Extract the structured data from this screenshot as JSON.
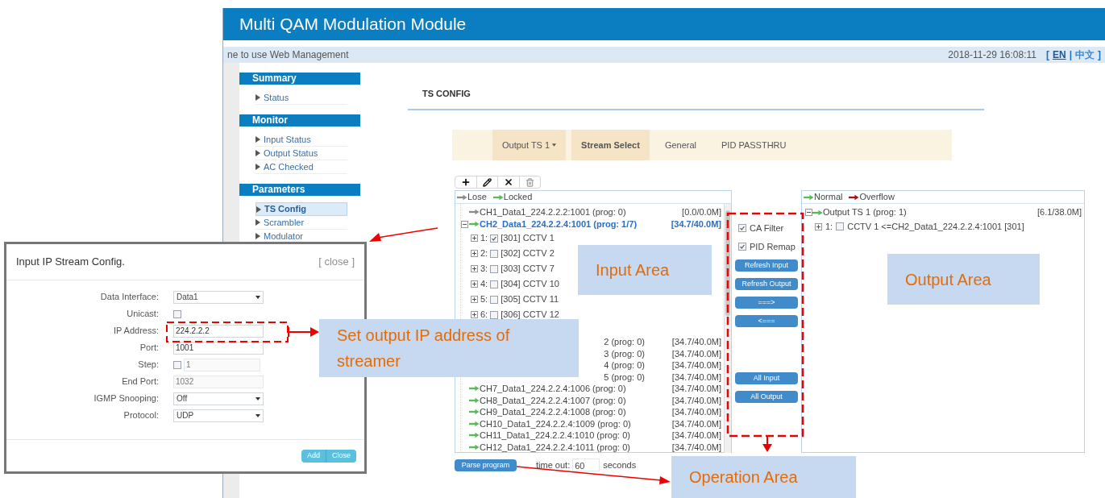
{
  "window": {
    "title": "Multi QAM Modulation Module"
  },
  "top_bar": {
    "welcome": "ne to use Web Management",
    "datetime": "2018-11-29 16:08:11",
    "language_switch": {
      "open": "[",
      "separator": "|",
      "close": "]",
      "languages": [
        {
          "label": "EN",
          "selected": true
        },
        {
          "label": "中文",
          "selected": false
        }
      ]
    }
  },
  "sidebar": {
    "sections": [
      {
        "title": "Summary",
        "items": [
          {
            "label": "Status",
            "selected": false
          }
        ]
      },
      {
        "title": "Monitor",
        "items": [
          {
            "label": "Input Status",
            "selected": false
          },
          {
            "label": "Output Status",
            "selected": false
          },
          {
            "label": "AC Checked",
            "selected": false
          }
        ]
      },
      {
        "title": "Parameters",
        "items": [
          {
            "label": "TS Config",
            "selected": true
          },
          {
            "label": "Scrambler",
            "selected": false
          },
          {
            "label": "Modulator",
            "selected": false
          }
        ]
      }
    ]
  },
  "page_title": "TS CONFIG",
  "tabs": [
    {
      "label": "Output TS 1",
      "kind": "dropdown",
      "selected": false
    },
    {
      "label": "Stream Select",
      "kind": "tab",
      "selected": true
    },
    {
      "label": "General",
      "kind": "tab",
      "selected": false
    },
    {
      "label": "PID PASSTHRU",
      "kind": "tab",
      "selected": false
    }
  ],
  "input_panel": {
    "legend": [
      {
        "label": "Lose",
        "color": "#8a8a8a"
      },
      {
        "label": "Locked",
        "color": "#5cb85c"
      }
    ],
    "channels": [
      {
        "kind": "channel",
        "label": "CH1_Data1_224.2.2.2:1001 (prog: 0)",
        "rate": "[0.0/0.0M]",
        "color": "#8a8a8a",
        "selected": false
      },
      {
        "kind": "channel",
        "label": "CH2_Data1_224.2.2.4:1001 (prog: 1/7)",
        "rate": "[34.7/40.0M]",
        "color": "#5cb85c",
        "selected": true,
        "expanded": true,
        "children": [
          {
            "number": "1:",
            "checked": true,
            "label": "[301] CCTV 1",
            "expanded": false
          },
          {
            "number": "2:",
            "checked": false,
            "label": "[302] CCTV 2",
            "expanded": false
          },
          {
            "number": "3:",
            "checked": false,
            "label": "[303] CCTV 7",
            "expanded": false
          },
          {
            "number": "4:",
            "checked": false,
            "label": "[304] CCTV 10",
            "expanded": false
          },
          {
            "number": "5:",
            "checked": false,
            "label": "[305] CCTV 11",
            "expanded": false
          },
          {
            "number": "6:",
            "checked": false,
            "label": "[306] CCTV 12",
            "expanded": false
          }
        ]
      },
      {
        "kind": "partial",
        "label": "2 (prog: 0)",
        "rate": "[34.7/40.0M]",
        "selected": false
      },
      {
        "kind": "partial",
        "label": "3 (prog: 0)",
        "rate": "[34.7/40.0M]",
        "selected": false
      },
      {
        "kind": "partial",
        "label": "4 (prog: 0)",
        "rate": "[34.7/40.0M]",
        "selected": false
      },
      {
        "kind": "partial",
        "label": "5 (prog: 0)",
        "rate": "[34.7/40.0M]",
        "selected": false
      },
      {
        "kind": "channel",
        "label": "CH7_Data1_224.2.2.4:1006 (prog: 0)",
        "rate": "[34.7/40.0M]",
        "color": "#5cb85c",
        "selected": false
      },
      {
        "kind": "channel",
        "label": "CH8_Data1_224.2.2.4:1007 (prog: 0)",
        "rate": "[34.7/40.0M]",
        "color": "#5cb85c",
        "selected": false
      },
      {
        "kind": "channel",
        "label": "CH9_Data1_224.2.2.4:1008 (prog: 0)",
        "rate": "[34.7/40.0M]",
        "color": "#5cb85c",
        "selected": false
      },
      {
        "kind": "channel",
        "label": "CH10_Data1_224.2.2.4:1009 (prog: 0)",
        "rate": "[34.7/40.0M]",
        "color": "#5cb85c",
        "selected": false
      },
      {
        "kind": "channel",
        "label": "CH11_Data1_224.2.2.4:1010 (prog: 0)",
        "rate": "[34.7/40.0M]",
        "color": "#5cb85c",
        "selected": false
      },
      {
        "kind": "channel",
        "label": "CH12_Data1_224.2.2.4:1011 (prog: 0)",
        "rate": "[34.7/40.0M]",
        "color": "#5cb85c",
        "selected": false
      }
    ]
  },
  "operation": {
    "options": [
      {
        "label": "CA Filter",
        "checked": true
      },
      {
        "label": "PID Remap",
        "checked": true
      }
    ],
    "buttons_top": [
      "Refresh Input",
      "Refresh Output",
      "===>",
      "<==="
    ],
    "buttons_bottom": [
      "All Input",
      "All Output"
    ]
  },
  "output_panel": {
    "legend": [
      {
        "label": "Normal",
        "color": "#5cb85c"
      },
      {
        "label": "Overflow",
        "color": "#a31515"
      }
    ],
    "outputs": [
      {
        "label": "Output TS 1 (prog: 1)",
        "rate": "[6.1/38.0M]",
        "color": "#5cb85c",
        "expanded": true,
        "children": [
          {
            "number": "1:",
            "checked": false,
            "label": "CCTV 1 <=CH2_Data1_224.2.2.4:1001 [301]",
            "expanded": false
          }
        ]
      }
    ]
  },
  "bottom": {
    "parse_button": "Parse program",
    "timeout_label": "time out:",
    "timeout_value": "60",
    "timeout_unit": "seconds"
  },
  "dialog": {
    "title": "Input IP Stream Config.",
    "close": "[ close ]",
    "fields": [
      {
        "label": "Data Interface:",
        "kind": "select",
        "value": "Data1"
      },
      {
        "label": "Unicast:",
        "kind": "checkbox",
        "checked": false
      },
      {
        "label": "IP Address:",
        "kind": "text",
        "value": "224.2.2.2",
        "disabled": false
      },
      {
        "label": "Port:",
        "kind": "text",
        "value": "1001",
        "disabled": false
      },
      {
        "label": "Step:",
        "kind": "checkbox_text",
        "checked": false,
        "value": "1",
        "disabled": true
      },
      {
        "label": "End Port:",
        "kind": "text",
        "value": "1032",
        "disabled": true
      },
      {
        "label": "IGMP Snooping:",
        "kind": "select",
        "value": "Off"
      },
      {
        "label": "Protocol:",
        "kind": "select",
        "value": "UDP"
      }
    ],
    "buttons": [
      "Add",
      "Close"
    ]
  },
  "callouts": [
    {
      "text": "Input Area"
    },
    {
      "text": "Output Area"
    },
    {
      "text": "Set output IP address of streamer"
    },
    {
      "text": "Operation Area"
    }
  ]
}
